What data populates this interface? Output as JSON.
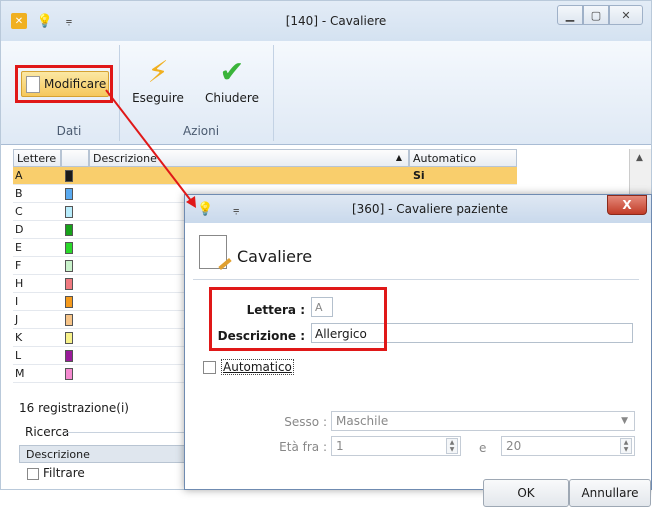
{
  "main_window": {
    "title": "[140] - Cavaliere",
    "quick_access": "⚲"
  },
  "ribbon": {
    "modificare_label": "Modificare",
    "eseguire_label": "Eseguire",
    "chiudere_label": "Chiudere",
    "group_dati": "Dati",
    "group_azioni": "Azioni"
  },
  "grid": {
    "headers": [
      "Lettere",
      "Descrizione",
      "Automatico"
    ],
    "rows": [
      {
        "letter": "A",
        "color": "#1a1a1a",
        "auto": "Si"
      },
      {
        "letter": "B",
        "color": "#5aaaf0",
        "auto": ""
      },
      {
        "letter": "C",
        "color": "#b8ecfb",
        "auto": ""
      },
      {
        "letter": "D",
        "color": "#17a21a",
        "auto": ""
      },
      {
        "letter": "E",
        "color": "#2ad82a",
        "auto": ""
      },
      {
        "letter": "F",
        "color": "#c9f2cb",
        "auto": ""
      },
      {
        "letter": "H",
        "color": "#f07a80",
        "auto": ""
      },
      {
        "letter": "I",
        "color": "#f59a1c",
        "auto": ""
      },
      {
        "letter": "J",
        "color": "#f6c488",
        "auto": ""
      },
      {
        "letter": "K",
        "color": "#f8f28a",
        "auto": ""
      },
      {
        "letter": "L",
        "color": "#9a1a9a",
        "auto": ""
      },
      {
        "letter": "M",
        "color": "#f58ad0",
        "auto": ""
      }
    ]
  },
  "bottom": {
    "records": "16 registrazione(i)",
    "ricerca": "Ricerca",
    "field_select": "Descrizione",
    "filtrare": "Filtrare"
  },
  "dialog": {
    "title": "[360] - Cavaliere paziente",
    "close_glyph": "X",
    "heading": "Cavaliere",
    "lettera_label": "Lettera :",
    "lettera_value": "A",
    "descrizione_label": "Descrizione :",
    "descrizione_value": "Allergico",
    "automatico_label": "Automatico",
    "sesso_label": "Sesso :",
    "sesso_value": "Maschile",
    "eta_label": "Età fra :",
    "eta_da": "1",
    "eta_e": "e",
    "eta_a": "20",
    "ok": "OK",
    "annullare": "Annullare"
  },
  "colors": {
    "highlight": "#e01818",
    "selected_row": "#f9ce6c"
  }
}
